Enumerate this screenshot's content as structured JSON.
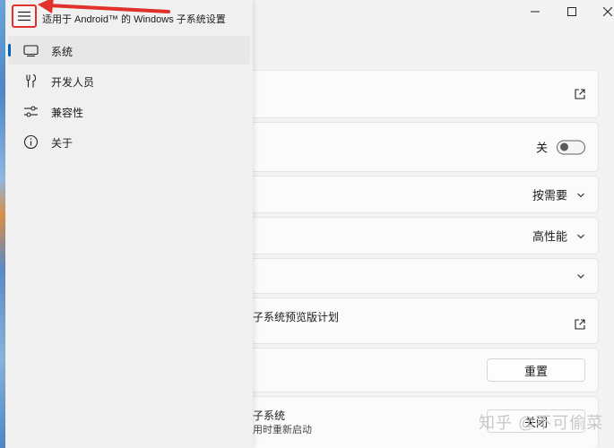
{
  "window": {
    "title": "适用于 Android™ 的 Windows 子系统设置",
    "minimize_icon": "minimize-icon",
    "maximize_icon": "maximize-icon",
    "close_icon": "close-icon"
  },
  "nav": {
    "menu_icon": "hamburger-menu-icon",
    "items": [
      {
        "label": "系统",
        "icon": "monitor-icon",
        "selected": true
      },
      {
        "label": "开发人员",
        "icon": "tools-icon",
        "selected": false
      },
      {
        "label": "兼容性",
        "icon": "sliders-icon",
        "selected": false
      },
      {
        "label": "关于",
        "icon": "info-icon",
        "selected": false
      }
    ]
  },
  "cards": {
    "toggle_label": "关",
    "resources_value": "按需要",
    "graphics_value": "高性能",
    "preview_text": "子系统预览版计划",
    "reset_label": "重置",
    "shutdown_title": "子系统",
    "shutdown_desc": "用时重新启动",
    "shutdown_button": "关闭"
  },
  "accent_color": "#005fb8",
  "annotation_color": "#e0322a",
  "watermark": "知乎 @不可偷菜"
}
